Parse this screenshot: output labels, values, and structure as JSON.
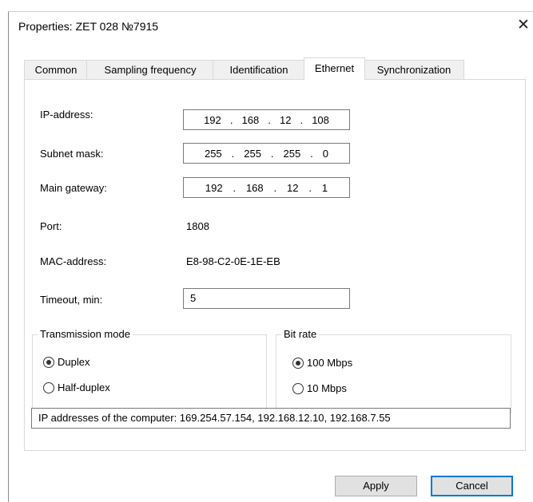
{
  "dialog": {
    "title": "Properties: ZET 028 №7915",
    "close_glyph": "✕"
  },
  "tabs": [
    {
      "label": "Common",
      "active": false
    },
    {
      "label": "Sampling frequency",
      "active": false
    },
    {
      "label": "Identification",
      "active": false
    },
    {
      "label": "Ethernet",
      "active": true
    },
    {
      "label": "Synchronization",
      "active": false
    }
  ],
  "ethernet": {
    "ip_address": {
      "label": "IP-address:",
      "octets": [
        "192",
        "168",
        "12",
        "108"
      ]
    },
    "subnet_mask": {
      "label": "Subnet mask:",
      "octets": [
        "255",
        "255",
        "255",
        "0"
      ]
    },
    "main_gateway": {
      "label": "Main gateway:",
      "octets": [
        "192",
        "168",
        "12",
        "1"
      ]
    },
    "port": {
      "label": "Port:",
      "value": "1808"
    },
    "mac": {
      "label": "MAC-address:",
      "value": "E8-98-C2-0E-1E-EB"
    },
    "timeout": {
      "label": "Timeout, min:",
      "value": "5"
    },
    "transmission_mode": {
      "legend": "Transmission mode",
      "options": [
        {
          "label": "Duplex",
          "selected": true
        },
        {
          "label": "Half-duplex",
          "selected": false
        }
      ]
    },
    "bit_rate": {
      "legend": "Bit rate",
      "options": [
        {
          "label": "100 Mbps",
          "selected": true
        },
        {
          "label": "10 Mbps",
          "selected": false
        }
      ]
    },
    "computer_ips": "IP addresses of the computer: 169.254.57.154, 192.168.12.10, 192.168.7.55"
  },
  "buttons": {
    "apply": "Apply",
    "cancel": "Cancel"
  },
  "colors": {
    "accent": "#0078d7",
    "button_face": "#e1e1e1"
  }
}
